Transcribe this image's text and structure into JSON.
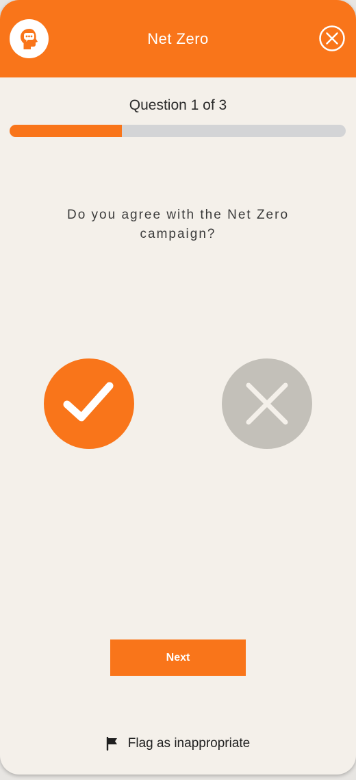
{
  "header": {
    "title": "Net Zero",
    "logo_icon": "speech-head-icon",
    "close_icon": "close-circle-icon",
    "accent_color": "#f9751a"
  },
  "progress": {
    "label": "Question 1 of 3",
    "current": 1,
    "total": 3,
    "fraction": 0.333
  },
  "question": {
    "text": "Do you agree with the Net Zero campaign?"
  },
  "answers": {
    "yes_icon": "checkmark-icon",
    "no_icon": "x-icon",
    "selected": "yes"
  },
  "actions": {
    "next_label": "Next",
    "flag_label": "Flag as inappropriate",
    "flag_icon": "flag-icon"
  }
}
